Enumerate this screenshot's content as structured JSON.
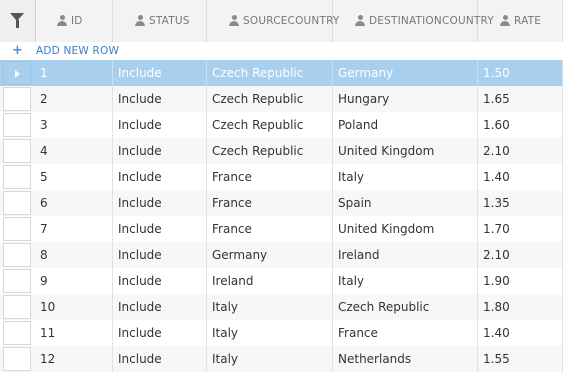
{
  "toolbar": {
    "filter_icon": "filter-icon"
  },
  "columns": [
    {
      "key": "id",
      "label": "ID",
      "icon": "user-icon"
    },
    {
      "key": "status",
      "label": "STATUS",
      "icon": "user-icon"
    },
    {
      "key": "source",
      "label": "SOURCECOUNTRY",
      "icon": "user-icon"
    },
    {
      "key": "dest",
      "label": "DESTINATIONCOUNTRY",
      "icon": "user-icon"
    },
    {
      "key": "rate",
      "label": "RATE",
      "icon": "user-icon"
    }
  ],
  "add_row": {
    "icon": "+",
    "label": "ADD NEW ROW"
  },
  "colors": {
    "selected_row": "#a8cfee",
    "accent": "#3a7fc1",
    "header_bg": "#f3f3f3"
  },
  "rows": [
    {
      "id": "1",
      "status": "Include",
      "source": "Czech Republic",
      "dest": "Germany",
      "rate": "1.50",
      "selected": true
    },
    {
      "id": "2",
      "status": "Include",
      "source": "Czech Republic",
      "dest": "Hungary",
      "rate": "1.65"
    },
    {
      "id": "3",
      "status": "Include",
      "source": "Czech Republic",
      "dest": "Poland",
      "rate": "1.60"
    },
    {
      "id": "4",
      "status": "Include",
      "source": "Czech Republic",
      "dest": "United Kingdom",
      "rate": "2.10"
    },
    {
      "id": "5",
      "status": "Include",
      "source": "France",
      "dest": "Italy",
      "rate": "1.40"
    },
    {
      "id": "6",
      "status": "Include",
      "source": "France",
      "dest": "Spain",
      "rate": "1.35"
    },
    {
      "id": "7",
      "status": "Include",
      "source": "France",
      "dest": "United Kingdom",
      "rate": "1.70"
    },
    {
      "id": "8",
      "status": "Include",
      "source": "Germany",
      "dest": "Ireland",
      "rate": "2.10"
    },
    {
      "id": "9",
      "status": "Include",
      "source": "Ireland",
      "dest": "Italy",
      "rate": "1.90"
    },
    {
      "id": "10",
      "status": "Include",
      "source": "Italy",
      "dest": "Czech Republic",
      "rate": "1.80"
    },
    {
      "id": "11",
      "status": "Include",
      "source": "Italy",
      "dest": "France",
      "rate": "1.40"
    },
    {
      "id": "12",
      "status": "Include",
      "source": "Italy",
      "dest": "Netherlands",
      "rate": "1.55"
    }
  ]
}
